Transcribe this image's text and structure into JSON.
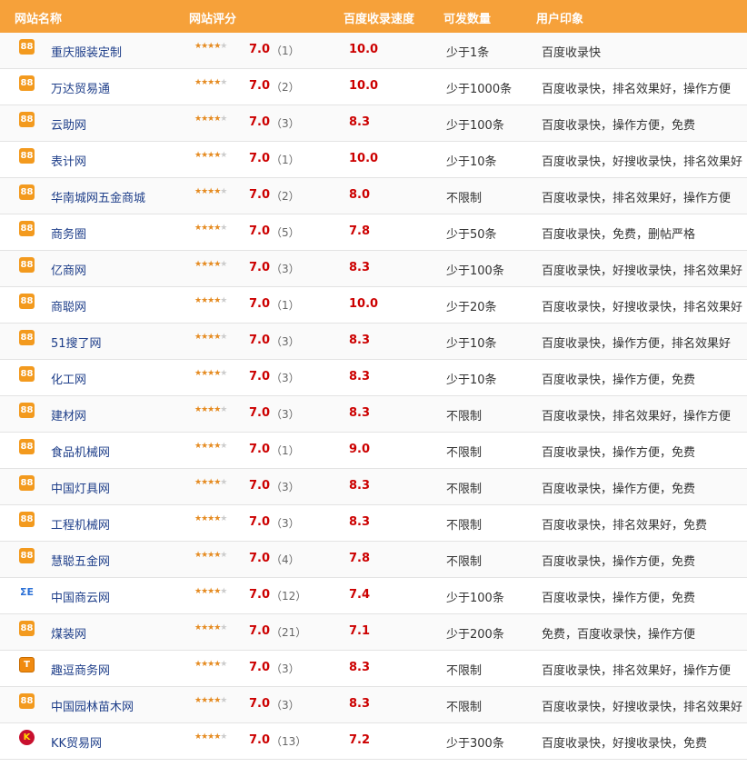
{
  "header": {
    "name": "网站名称",
    "rating": "网站评分",
    "speed": "百度收录速度",
    "qty": "可发数量",
    "impression": "用户印象"
  },
  "rows": [
    {
      "name": "重庆服装定制",
      "score": "7.0",
      "count": "（1）",
      "speed": "10.0",
      "qty": "少于1条",
      "impression": "百度收录快",
      "icon": "88"
    },
    {
      "name": "万达贸易通",
      "score": "7.0",
      "count": "（2）",
      "speed": "10.0",
      "qty": "少于1000条",
      "impression": "百度收录快，排名效果好，操作方便",
      "icon": "88"
    },
    {
      "name": "云助网",
      "score": "7.0",
      "count": "（3）",
      "speed": "8.3",
      "qty": "少于100条",
      "impression": "百度收录快，操作方便，免费",
      "icon": "88"
    },
    {
      "name": "表计网",
      "score": "7.0",
      "count": "（1）",
      "speed": "10.0",
      "qty": "少于10条",
      "impression": "百度收录快，好搜收录快，排名效果好",
      "icon": "88"
    },
    {
      "name": "华南城网五金商城",
      "score": "7.0",
      "count": "（2）",
      "speed": "8.0",
      "qty": "不限制",
      "impression": "百度收录快，排名效果好，操作方便",
      "icon": "88"
    },
    {
      "name": "商务圈",
      "score": "7.0",
      "count": "（5）",
      "speed": "7.8",
      "qty": "少于50条",
      "impression": "百度收录快，免费，删帖严格",
      "icon": "88"
    },
    {
      "name": "亿商网",
      "score": "7.0",
      "count": "（3）",
      "speed": "8.3",
      "qty": "少于100条",
      "impression": "百度收录快，好搜收录快，排名效果好",
      "icon": "88"
    },
    {
      "name": "商聪网",
      "score": "7.0",
      "count": "（1）",
      "speed": "10.0",
      "qty": "少于20条",
      "impression": "百度收录快，好搜收录快，排名效果好",
      "icon": "88"
    },
    {
      "name": "51搜了网",
      "score": "7.0",
      "count": "（3）",
      "speed": "8.3",
      "qty": "少于10条",
      "impression": "百度收录快，操作方便，排名效果好",
      "icon": "88"
    },
    {
      "name": "化工网",
      "score": "7.0",
      "count": "（3）",
      "speed": "8.3",
      "qty": "少于10条",
      "impression": "百度收录快，操作方便，免费",
      "icon": "88"
    },
    {
      "name": "建材网",
      "score": "7.0",
      "count": "（3）",
      "speed": "8.3",
      "qty": "不限制",
      "impression": "百度收录快，排名效果好，操作方便",
      "icon": "88"
    },
    {
      "name": "食品机械网",
      "score": "7.0",
      "count": "（1）",
      "speed": "9.0",
      "qty": "不限制",
      "impression": "百度收录快，操作方便，免费",
      "icon": "88"
    },
    {
      "name": "中国灯具网",
      "score": "7.0",
      "count": "（3）",
      "speed": "8.3",
      "qty": "不限制",
      "impression": "百度收录快，操作方便，免费",
      "icon": "88"
    },
    {
      "name": "工程机械网",
      "score": "7.0",
      "count": "（3）",
      "speed": "8.3",
      "qty": "不限制",
      "impression": "百度收录快，排名效果好，免费",
      "icon": "88"
    },
    {
      "name": "慧聪五金网",
      "score": "7.0",
      "count": "（4）",
      "speed": "7.8",
      "qty": "不限制",
      "impression": "百度收录快，操作方便，免费",
      "icon": "88"
    },
    {
      "name": "中国商云网",
      "score": "7.0",
      "count": "（12）",
      "speed": "7.4",
      "qty": "少于100条",
      "impression": "百度收录快，操作方便，免费",
      "icon": "ce"
    },
    {
      "name": "煤装网",
      "score": "7.0",
      "count": "（21）",
      "speed": "7.1",
      "qty": "少于200条",
      "impression": "免费，百度收录快，操作方便",
      "icon": "88"
    },
    {
      "name": "趣逗商务网",
      "score": "7.0",
      "count": "（3）",
      "speed": "8.3",
      "qty": "不限制",
      "impression": "百度收录快，排名效果好，操作方便",
      "icon": "t"
    },
    {
      "name": "中国园林苗木网",
      "score": "7.0",
      "count": "（3）",
      "speed": "8.3",
      "qty": "不限制",
      "impression": "百度收录快，好搜收录快，排名效果好",
      "icon": "88"
    },
    {
      "name": "KK贸易网",
      "score": "7.0",
      "count": "（13）",
      "speed": "7.2",
      "qty": "少于300条",
      "impression": "百度收录快，好搜收录快，免费",
      "icon": "K"
    }
  ],
  "star_rating": {
    "filled": 3.5,
    "max": 5
  },
  "colors": {
    "header_bg": "#f6a13a",
    "score": "#cc0000",
    "name_link": "#1f3f8a"
  }
}
